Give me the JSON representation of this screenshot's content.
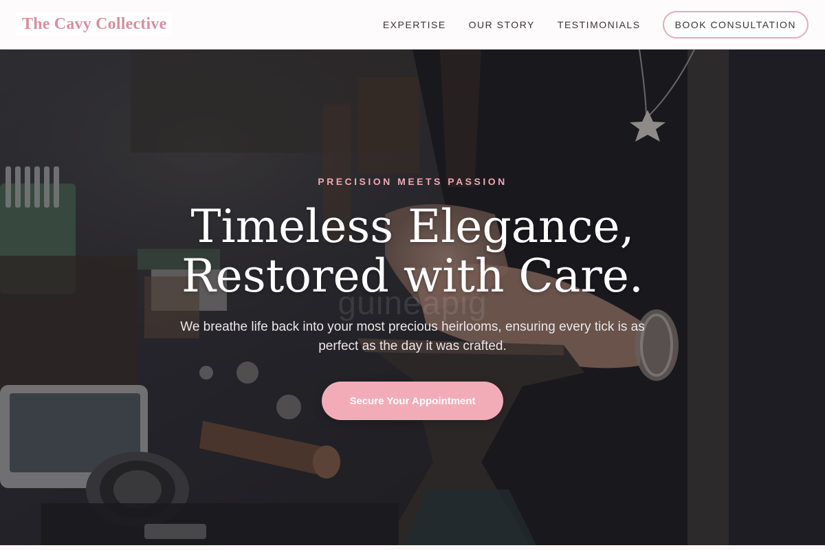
{
  "header": {
    "brand": "The Cavy Collective",
    "nav": [
      {
        "label": "EXPERTISE"
      },
      {
        "label": "OUR STORY"
      },
      {
        "label": "TESTIMONIALS"
      }
    ],
    "cta_label": "BOOK CONSULTATION"
  },
  "hero": {
    "eyebrow": "PRECISION MEETS PASSION",
    "title_line1": "Timeless Elegance,",
    "title_line2": "Restored with Care.",
    "watermark": "guineapig",
    "subtitle": "We breathe life back into your most precious heirlooms, ensuring every tick is as perfect as the day it was crafted.",
    "cta_label": "Secure Your Appointment"
  },
  "colors": {
    "brand_pink": "#d58f9e",
    "accent_pink": "#f2acb8",
    "eyebrow_pink": "#f0a6b3",
    "outline_pink": "#e8a9b5",
    "nav_text": "#3b3337"
  }
}
